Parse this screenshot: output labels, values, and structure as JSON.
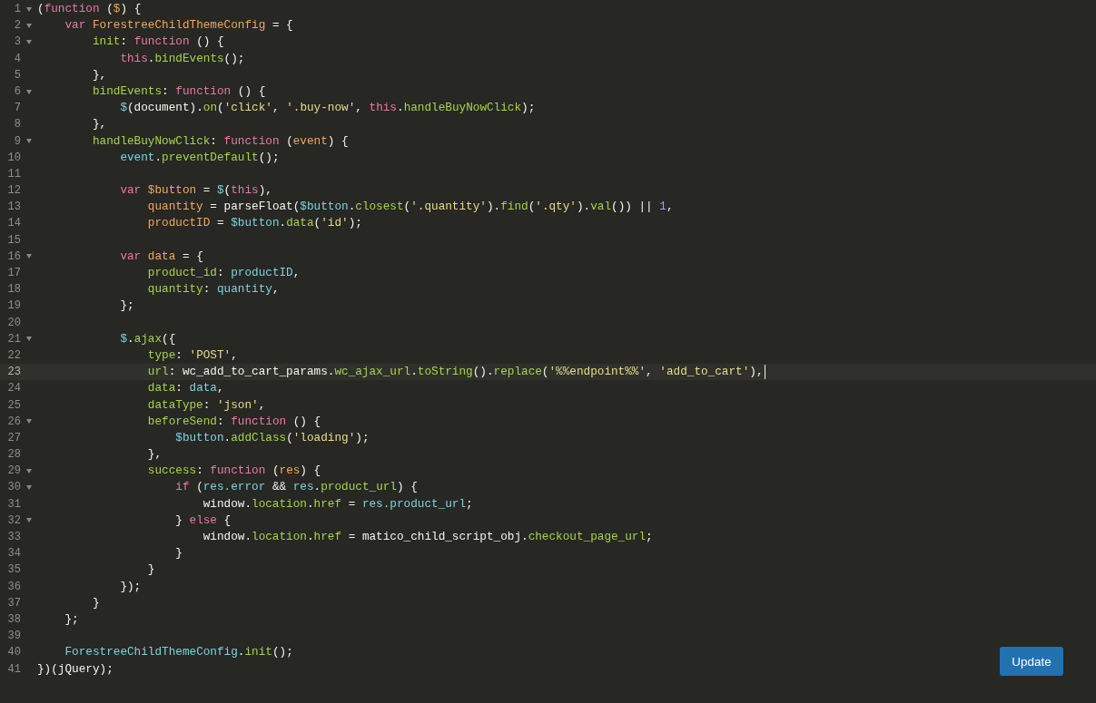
{
  "editor": {
    "lines": [
      {
        "number": "1",
        "foldable": true,
        "active": false,
        "tokens": [
          {
            "text": "(",
            "kind": "plain"
          },
          {
            "text": "function",
            "kind": "keyword"
          },
          {
            "text": " (",
            "kind": "plain"
          },
          {
            "text": "$",
            "kind": "def"
          },
          {
            "text": ") {",
            "kind": "plain"
          }
        ]
      },
      {
        "number": "2",
        "foldable": true,
        "active": false,
        "tokens": [
          {
            "text": "    var ",
            "kind": "keyword"
          },
          {
            "text": "ForestreeChildThemeConfig",
            "kind": "def"
          },
          {
            "text": " = {",
            "kind": "plain"
          }
        ]
      },
      {
        "number": "3",
        "foldable": true,
        "active": false,
        "tokens": [
          {
            "text": "        init",
            "kind": "prop"
          },
          {
            "text": ": ",
            "kind": "plain"
          },
          {
            "text": "function",
            "kind": "keyword"
          },
          {
            "text": " () {",
            "kind": "plain"
          }
        ]
      },
      {
        "number": "4",
        "foldable": false,
        "active": false,
        "tokens": [
          {
            "text": "            this",
            "kind": "keyword"
          },
          {
            "text": ".",
            "kind": "plain"
          },
          {
            "text": "bindEvents",
            "kind": "prop"
          },
          {
            "text": "();",
            "kind": "plain"
          }
        ]
      },
      {
        "number": "5",
        "foldable": false,
        "active": false,
        "tokens": [
          {
            "text": "        },",
            "kind": "plain"
          }
        ]
      },
      {
        "number": "6",
        "foldable": true,
        "active": false,
        "tokens": [
          {
            "text": "        bindEvents",
            "kind": "prop"
          },
          {
            "text": ": ",
            "kind": "plain"
          },
          {
            "text": "function",
            "kind": "keyword"
          },
          {
            "text": " () {",
            "kind": "plain"
          }
        ]
      },
      {
        "number": "7",
        "foldable": false,
        "active": false,
        "tokens": [
          {
            "text": "            $",
            "kind": "var"
          },
          {
            "text": "(document).",
            "kind": "plain"
          },
          {
            "text": "on",
            "kind": "prop"
          },
          {
            "text": "(",
            "kind": "plain"
          },
          {
            "text": "'click'",
            "kind": "string"
          },
          {
            "text": ", ",
            "kind": "plain"
          },
          {
            "text": "'.buy-now'",
            "kind": "string"
          },
          {
            "text": ", ",
            "kind": "plain"
          },
          {
            "text": "this",
            "kind": "keyword"
          },
          {
            "text": ".",
            "kind": "plain"
          },
          {
            "text": "handleBuyNowClick",
            "kind": "prop"
          },
          {
            "text": ");",
            "kind": "plain"
          }
        ]
      },
      {
        "number": "8",
        "foldable": false,
        "active": false,
        "tokens": [
          {
            "text": "        },",
            "kind": "plain"
          }
        ]
      },
      {
        "number": "9",
        "foldable": true,
        "active": false,
        "tokens": [
          {
            "text": "        handleBuyNowClick",
            "kind": "prop"
          },
          {
            "text": ": ",
            "kind": "plain"
          },
          {
            "text": "function",
            "kind": "keyword"
          },
          {
            "text": " (",
            "kind": "plain"
          },
          {
            "text": "event",
            "kind": "def"
          },
          {
            "text": ") {",
            "kind": "plain"
          }
        ]
      },
      {
        "number": "10",
        "foldable": false,
        "active": false,
        "tokens": [
          {
            "text": "            event",
            "kind": "var"
          },
          {
            "text": ".",
            "kind": "plain"
          },
          {
            "text": "preventDefault",
            "kind": "prop"
          },
          {
            "text": "();",
            "kind": "plain"
          }
        ]
      },
      {
        "number": "11",
        "foldable": false,
        "active": false
      },
      {
        "number": "12",
        "foldable": false,
        "active": false,
        "tokens": [
          {
            "text": "            var ",
            "kind": "keyword"
          },
          {
            "text": "$button",
            "kind": "def"
          },
          {
            "text": " = ",
            "kind": "plain"
          },
          {
            "text": "$",
            "kind": "var"
          },
          {
            "text": "(",
            "kind": "plain"
          },
          {
            "text": "this",
            "kind": "keyword"
          },
          {
            "text": "),",
            "kind": "plain"
          }
        ]
      },
      {
        "number": "13",
        "foldable": false,
        "active": false,
        "tokens": [
          {
            "text": "                quantity",
            "kind": "def"
          },
          {
            "text": " = parseFloat(",
            "kind": "plain"
          },
          {
            "text": "$button",
            "kind": "var"
          },
          {
            "text": ".",
            "kind": "plain"
          },
          {
            "text": "closest",
            "kind": "prop"
          },
          {
            "text": "(",
            "kind": "plain"
          },
          {
            "text": "'.quantity'",
            "kind": "string"
          },
          {
            "text": ").",
            "kind": "plain"
          },
          {
            "text": "find",
            "kind": "prop"
          },
          {
            "text": "(",
            "kind": "plain"
          },
          {
            "text": "'.qty'",
            "kind": "string"
          },
          {
            "text": ").",
            "kind": "plain"
          },
          {
            "text": "val",
            "kind": "prop"
          },
          {
            "text": "()) || ",
            "kind": "plain"
          },
          {
            "text": "1",
            "kind": "number"
          },
          {
            "text": ",",
            "kind": "plain"
          }
        ]
      },
      {
        "number": "14",
        "foldable": false,
        "active": false,
        "tokens": [
          {
            "text": "                productID",
            "kind": "def"
          },
          {
            "text": " = ",
            "kind": "plain"
          },
          {
            "text": "$button",
            "kind": "var"
          },
          {
            "text": ".",
            "kind": "plain"
          },
          {
            "text": "data",
            "kind": "prop"
          },
          {
            "text": "(",
            "kind": "plain"
          },
          {
            "text": "'id'",
            "kind": "string"
          },
          {
            "text": ");",
            "kind": "plain"
          }
        ]
      },
      {
        "number": "15",
        "foldable": false,
        "active": false
      },
      {
        "number": "16",
        "foldable": true,
        "active": false,
        "tokens": [
          {
            "text": "            var ",
            "kind": "keyword"
          },
          {
            "text": "data",
            "kind": "def"
          },
          {
            "text": " = {",
            "kind": "plain"
          }
        ]
      },
      {
        "number": "17",
        "foldable": false,
        "active": false,
        "tokens": [
          {
            "text": "                product_id",
            "kind": "prop"
          },
          {
            "text": ": ",
            "kind": "plain"
          },
          {
            "text": "productID",
            "kind": "var"
          },
          {
            "text": ",",
            "kind": "plain"
          }
        ]
      },
      {
        "number": "18",
        "foldable": false,
        "active": false,
        "tokens": [
          {
            "text": "                quantity",
            "kind": "prop"
          },
          {
            "text": ": ",
            "kind": "plain"
          },
          {
            "text": "quantity",
            "kind": "var"
          },
          {
            "text": ",",
            "kind": "plain"
          }
        ]
      },
      {
        "number": "19",
        "foldable": false,
        "active": false,
        "tokens": [
          {
            "text": "            };",
            "kind": "plain"
          }
        ]
      },
      {
        "number": "20",
        "foldable": false,
        "active": false
      },
      {
        "number": "21",
        "foldable": true,
        "active": false,
        "tokens": [
          {
            "text": "            $",
            "kind": "var"
          },
          {
            "text": ".",
            "kind": "plain"
          },
          {
            "text": "ajax",
            "kind": "prop"
          },
          {
            "text": "({",
            "kind": "plain"
          }
        ]
      },
      {
        "number": "22",
        "foldable": false,
        "active": false,
        "tokens": [
          {
            "text": "                type",
            "kind": "prop"
          },
          {
            "text": ": ",
            "kind": "plain"
          },
          {
            "text": "'POST'",
            "kind": "string"
          },
          {
            "text": ",",
            "kind": "plain"
          }
        ]
      },
      {
        "number": "23",
        "foldable": false,
        "active": true,
        "tokens": [
          {
            "text": "                url",
            "kind": "prop"
          },
          {
            "text": ": wc_add_to_cart_params.",
            "kind": "plain"
          },
          {
            "text": "wc_ajax_url",
            "kind": "prop"
          },
          {
            "text": ".",
            "kind": "plain"
          },
          {
            "text": "toString",
            "kind": "prop"
          },
          {
            "text": "().",
            "kind": "plain"
          },
          {
            "text": "replace",
            "kind": "prop"
          },
          {
            "text": "(",
            "kind": "plain"
          },
          {
            "text": "'%%endpoint%%'",
            "kind": "string"
          },
          {
            "text": ", ",
            "kind": "plain"
          },
          {
            "text": "'add_to_cart'",
            "kind": "string"
          },
          {
            "text": "),",
            "kind": "plain"
          }
        ]
      },
      {
        "number": "24",
        "foldable": false,
        "active": false,
        "tokens": [
          {
            "text": "                data",
            "kind": "prop"
          },
          {
            "text": ": ",
            "kind": "plain"
          },
          {
            "text": "data",
            "kind": "var"
          },
          {
            "text": ",",
            "kind": "plain"
          }
        ]
      },
      {
        "number": "25",
        "foldable": false,
        "active": false,
        "tokens": [
          {
            "text": "                dataType",
            "kind": "prop"
          },
          {
            "text": ": ",
            "kind": "plain"
          },
          {
            "text": "'json'",
            "kind": "string"
          },
          {
            "text": ",",
            "kind": "plain"
          }
        ]
      },
      {
        "number": "26",
        "foldable": true,
        "active": false,
        "tokens": [
          {
            "text": "                beforeSend",
            "kind": "prop"
          },
          {
            "text": ": ",
            "kind": "plain"
          },
          {
            "text": "function",
            "kind": "keyword"
          },
          {
            "text": " () {",
            "kind": "plain"
          }
        ]
      },
      {
        "number": "27",
        "foldable": false,
        "active": false,
        "tokens": [
          {
            "text": "                    $button",
            "kind": "var"
          },
          {
            "text": ".",
            "kind": "plain"
          },
          {
            "text": "addClass",
            "kind": "prop"
          },
          {
            "text": "(",
            "kind": "plain"
          },
          {
            "text": "'loading'",
            "kind": "string"
          },
          {
            "text": ");",
            "kind": "plain"
          }
        ]
      },
      {
        "number": "28",
        "foldable": false,
        "active": false,
        "tokens": [
          {
            "text": "                },",
            "kind": "plain"
          }
        ]
      },
      {
        "number": "29",
        "foldable": true,
        "active": false,
        "tokens": [
          {
            "text": "                success",
            "kind": "prop"
          },
          {
            "text": ": ",
            "kind": "plain"
          },
          {
            "text": "function",
            "kind": "keyword"
          },
          {
            "text": " (",
            "kind": "plain"
          },
          {
            "text": "res",
            "kind": "def"
          },
          {
            "text": ") {",
            "kind": "plain"
          }
        ]
      },
      {
        "number": "30",
        "foldable": true,
        "active": false,
        "tokens": [
          {
            "text": "                    if",
            "kind": "keyword"
          },
          {
            "text": " (",
            "kind": "plain"
          },
          {
            "text": "res.error",
            "kind": "var"
          },
          {
            "text": " && ",
            "kind": "plain"
          },
          {
            "text": "res",
            "kind": "var"
          },
          {
            "text": ".",
            "kind": "plain"
          },
          {
            "text": "product_url",
            "kind": "prop"
          },
          {
            "text": ") {",
            "kind": "plain"
          }
        ]
      },
      {
        "number": "31",
        "foldable": false,
        "active": false,
        "tokens": [
          {
            "text": "                        window.",
            "kind": "plain"
          },
          {
            "text": "location",
            "kind": "prop"
          },
          {
            "text": ".",
            "kind": "plain"
          },
          {
            "text": "href",
            "kind": "prop"
          },
          {
            "text": " = ",
            "kind": "plain"
          },
          {
            "text": "res.product_url",
            "kind": "var"
          },
          {
            "text": ";",
            "kind": "plain"
          }
        ]
      },
      {
        "number": "32",
        "foldable": true,
        "active": false,
        "tokens": [
          {
            "text": "                    } ",
            "kind": "plain"
          },
          {
            "text": "else",
            "kind": "keyword"
          },
          {
            "text": " {",
            "kind": "plain"
          }
        ]
      },
      {
        "number": "33",
        "foldable": false,
        "active": false,
        "tokens": [
          {
            "text": "                        window.",
            "kind": "plain"
          },
          {
            "text": "location",
            "kind": "prop"
          },
          {
            "text": ".",
            "kind": "plain"
          },
          {
            "text": "href",
            "kind": "prop"
          },
          {
            "text": " = matico_child_script_obj.",
            "kind": "plain"
          },
          {
            "text": "checkout_page_url",
            "kind": "prop"
          },
          {
            "text": ";",
            "kind": "plain"
          }
        ]
      },
      {
        "number": "34",
        "foldable": false,
        "active": false,
        "tokens": [
          {
            "text": "                    }",
            "kind": "plain"
          }
        ]
      },
      {
        "number": "35",
        "foldable": false,
        "active": false,
        "tokens": [
          {
            "text": "                }",
            "kind": "plain"
          }
        ]
      },
      {
        "number": "36",
        "foldable": false,
        "active": false,
        "tokens": [
          {
            "text": "            });",
            "kind": "plain"
          }
        ]
      },
      {
        "number": "37",
        "foldable": false,
        "active": false,
        "tokens": [
          {
            "text": "        }",
            "kind": "plain"
          }
        ]
      },
      {
        "number": "38",
        "foldable": false,
        "active": false,
        "tokens": [
          {
            "text": "    };",
            "kind": "plain"
          }
        ]
      },
      {
        "number": "39",
        "foldable": false,
        "active": false
      },
      {
        "number": "40",
        "foldable": false,
        "active": false,
        "tokens": [
          {
            "text": "    ForestreeChildThemeConfig",
            "kind": "var"
          },
          {
            "text": ".",
            "kind": "plain"
          },
          {
            "text": "init",
            "kind": "prop"
          },
          {
            "text": "();",
            "kind": "plain"
          }
        ]
      },
      {
        "number": "41",
        "foldable": false,
        "active": false,
        "tokens": [
          {
            "text": "})(jQuery);",
            "kind": "plain"
          }
        ]
      }
    ]
  },
  "update_button": {
    "label": "Update"
  }
}
